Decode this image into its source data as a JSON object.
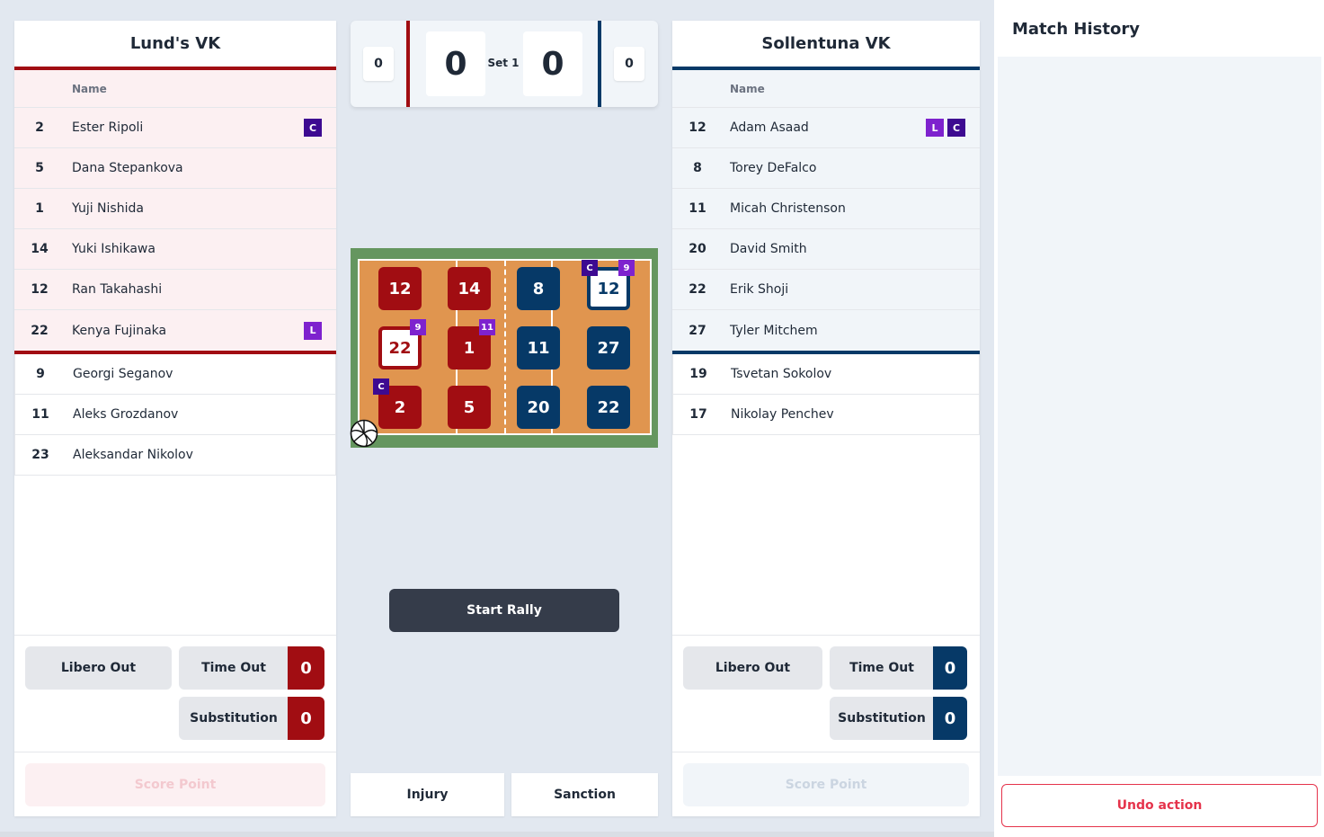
{
  "left_team": {
    "name": "Lund's VK",
    "name_header": "Name",
    "court_players": [
      {
        "number": "2",
        "name": "Ester Ripoli",
        "badges": [
          "C"
        ]
      },
      {
        "number": "5",
        "name": "Dana Stepankova",
        "badges": []
      },
      {
        "number": "1",
        "name": "Yuji Nishida",
        "badges": []
      },
      {
        "number": "14",
        "name": "Yuki Ishikawa",
        "badges": []
      },
      {
        "number": "12",
        "name": "Ran Takahashi",
        "badges": []
      },
      {
        "number": "22",
        "name": "Kenya Fujinaka",
        "badges": [
          "L"
        ]
      }
    ],
    "bench_players": [
      {
        "number": "9",
        "name": "Georgi Seganov"
      },
      {
        "number": "11",
        "name": "Aleks Grozdanov"
      },
      {
        "number": "23",
        "name": "Aleksandar Nikolov"
      }
    ],
    "libero_out": "Libero Out",
    "time_out": "Time Out",
    "time_out_count": "0",
    "substitution": "Substitution",
    "substitution_count": "0",
    "score_point": "Score Point",
    "color": "#a10d12"
  },
  "right_team": {
    "name": "Sollentuna VK",
    "name_header": "Name",
    "court_players": [
      {
        "number": "12",
        "name": "Adam Asaad",
        "badges": [
          "L",
          "C"
        ]
      },
      {
        "number": "8",
        "name": "Torey DeFalco",
        "badges": []
      },
      {
        "number": "11",
        "name": "Micah Christenson",
        "badges": []
      },
      {
        "number": "20",
        "name": "David Smith",
        "badges": []
      },
      {
        "number": "22",
        "name": "Erik Shoji",
        "badges": []
      },
      {
        "number": "27",
        "name": "Tyler Mitchem",
        "badges": []
      }
    ],
    "bench_players": [
      {
        "number": "19",
        "name": "Tsvetan Sokolov"
      },
      {
        "number": "17",
        "name": "Nikolay Penchev"
      }
    ],
    "libero_out": "Libero Out",
    "time_out": "Time Out",
    "time_out_count": "0",
    "substitution": "Substitution",
    "substitution_count": "0",
    "score_point": "Score Point",
    "color": "#063967"
  },
  "scoreboard": {
    "left_sets": "0",
    "left_points": "0",
    "set_label": "Set 1",
    "right_points": "0",
    "right_sets": "0"
  },
  "court": {
    "left_tiles": {
      "r1c1": "12",
      "r1c2": "14",
      "r2c1": "22",
      "r2c2": "1",
      "r3c1": "2",
      "r3c2": "5",
      "r2c1_badge": "9",
      "r2c2_badge": "11",
      "r3c1_badge": "C"
    },
    "right_tiles": {
      "r1c1": "8",
      "r1c2": "12",
      "r2c1": "11",
      "r2c2": "27",
      "r3c1": "20",
      "r3c2": "22",
      "r1c2_badge_left": "C",
      "r1c2_badge_right": "9"
    }
  },
  "controls": {
    "start_rally": "Start Rally",
    "injury": "Injury",
    "sanction": "Sanction"
  },
  "history": {
    "title": "Match History",
    "undo": "Undo action"
  }
}
